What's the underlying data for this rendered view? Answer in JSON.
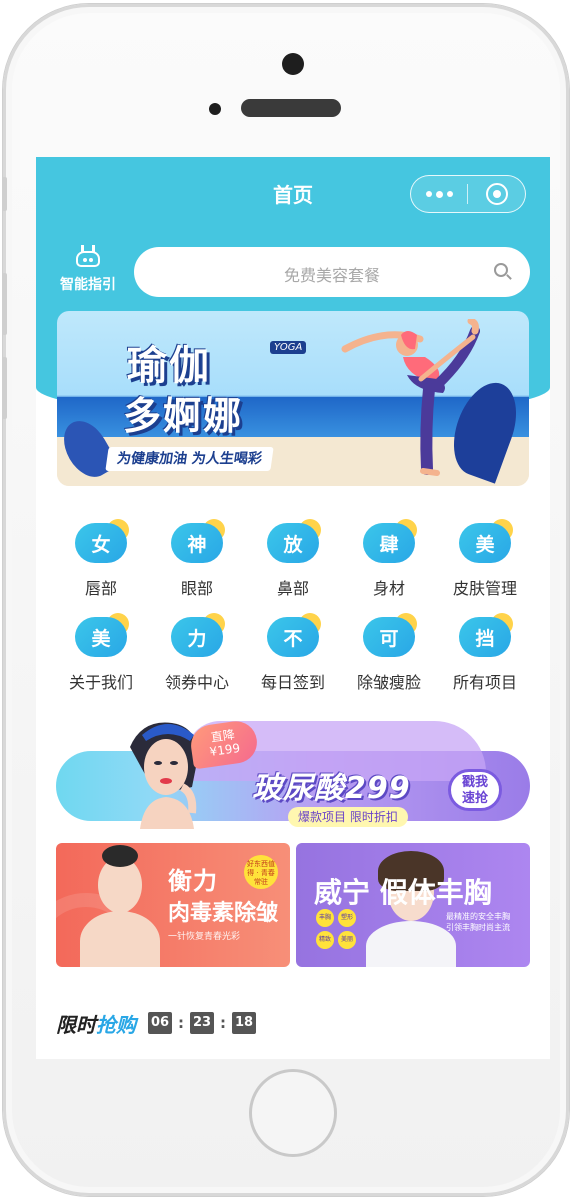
{
  "navbar": {
    "title": "首页"
  },
  "guide": {
    "label": "智能指引"
  },
  "search": {
    "placeholder": "免费美容套餐"
  },
  "banner_yoga": {
    "title_line1": "瑜伽",
    "title_line2": "多婀娜",
    "tag": "YOGA",
    "slogan": "为健康加油  为人生喝彩"
  },
  "categories": [
    {
      "glyph": "女",
      "label": "唇部"
    },
    {
      "glyph": "神",
      "label": "眼部"
    },
    {
      "glyph": "放",
      "label": "鼻部"
    },
    {
      "glyph": "肆",
      "label": "身材"
    },
    {
      "glyph": "美",
      "label": "皮肤管理"
    },
    {
      "glyph": "美",
      "label": "关于我们"
    },
    {
      "glyph": "力",
      "label": "领券中心"
    },
    {
      "glyph": "不",
      "label": "每日签到"
    },
    {
      "glyph": "可",
      "label": "除皱瘦脸"
    },
    {
      "glyph": "挡",
      "label": "所有项目"
    }
  ],
  "banner_hya": {
    "badge_line1": "直降",
    "badge_line2": "¥199",
    "title": "玻尿酸299",
    "sub": "爆款项目  限时折扣",
    "cta_line1": "戳我",
    "cta_line2": "速抢"
  },
  "promo_left": {
    "title1": "衡力",
    "title2": "肉毒素除皱",
    "sticker": "好东西值得 · 青春常驻",
    "line": "一针恢复青春光彩"
  },
  "promo_right": {
    "title": "威宁 假体丰胸",
    "chips": [
      "丰胸",
      "塑形",
      "精致",
      "美丽"
    ],
    "note": "最精准的安全丰胸 引领丰胸时尚主流"
  },
  "flash_sale": {
    "label_a": "限时",
    "label_b": "抢购",
    "hours": "06",
    "minutes": "23",
    "seconds": "18",
    "separator": ":"
  },
  "colors": {
    "theme": "#45c6e0",
    "category_bubble": "#29a7e6",
    "category_sun": "#ffd34a",
    "promo_left": "#f3695a",
    "promo_right": "#9673e0"
  }
}
